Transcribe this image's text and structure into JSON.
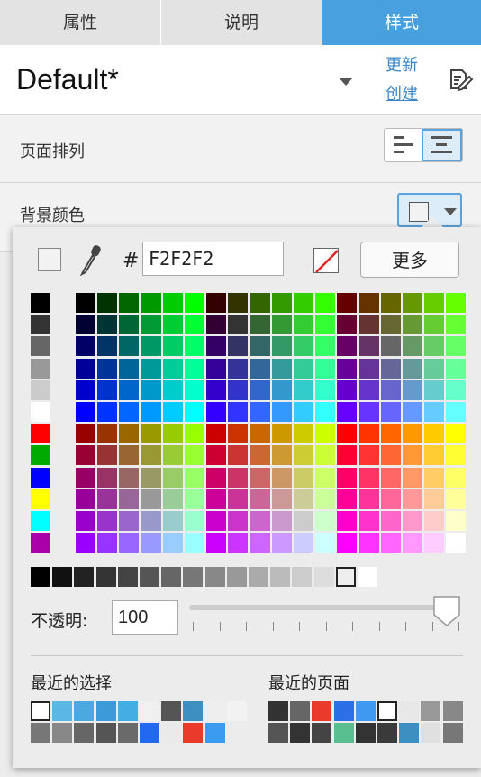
{
  "tabs": [
    {
      "label": "属性"
    },
    {
      "label": "说明"
    },
    {
      "label": "样式"
    }
  ],
  "header": {
    "style_name": "Default*",
    "update_link": "更新",
    "create_link": "创建"
  },
  "page_align": {
    "label": "页面排列"
  },
  "background": {
    "label": "背景颜色"
  },
  "picker": {
    "hash": "#",
    "hex_value": "F2F2F2",
    "more_label": "更多",
    "opacity_label": "不透明:",
    "opacity_value": "100",
    "recent_selection_label": "最近的选择",
    "recent_pages_label": "最近的页面",
    "current_color": "#F2F2F2"
  },
  "colors": {
    "tab_active": "#48a0de",
    "link": "#3b87c9",
    "accent": "#5aa3dc"
  },
  "palette": {
    "left_column": [
      "#000000",
      "#333333",
      "#666666",
      "#999999",
      "#cccccc",
      "#ffffff",
      "#ff0000",
      "#00aa00",
      "#0000ff",
      "#ffff00",
      "#00ffff",
      "#aa00aa"
    ],
    "grayscale": [
      "#000000",
      "#111111",
      "#222222",
      "#333333",
      "#444444",
      "#555555",
      "#666666",
      "#777777",
      "#888888",
      "#999999",
      "#aaaaaa",
      "#bbbbbb",
      "#cccccc",
      "#dddddd",
      "#eeeeee",
      "#ffffff"
    ],
    "recent_selection": [
      "#ffffff",
      "#5ab7e6",
      "#4ca9e0",
      "#3d9ad8",
      "#42aee4",
      "#f0f0f0",
      "#555555",
      "#3d8fc2",
      "#eeeeee",
      "#f2f2f2",
      "#777777",
      "#888888",
      "#666666",
      "#555555",
      "#6a6a6a",
      "#2268f0",
      "#eaeaea",
      "#e93a2b",
      "#3a9bf0"
    ],
    "recent_pages": [
      "#333333",
      "#666666",
      "#e93a2b",
      "#2d6fe6",
      "#3d9af0",
      "#ffffff",
      "#e8e8e8",
      "#999999",
      "#888888",
      "#555555",
      "#333333",
      "#444444",
      "#5abf90",
      "#333333",
      "#3a3a3a",
      "#3d8fc2",
      "#e0e0e0",
      "#777777"
    ]
  }
}
